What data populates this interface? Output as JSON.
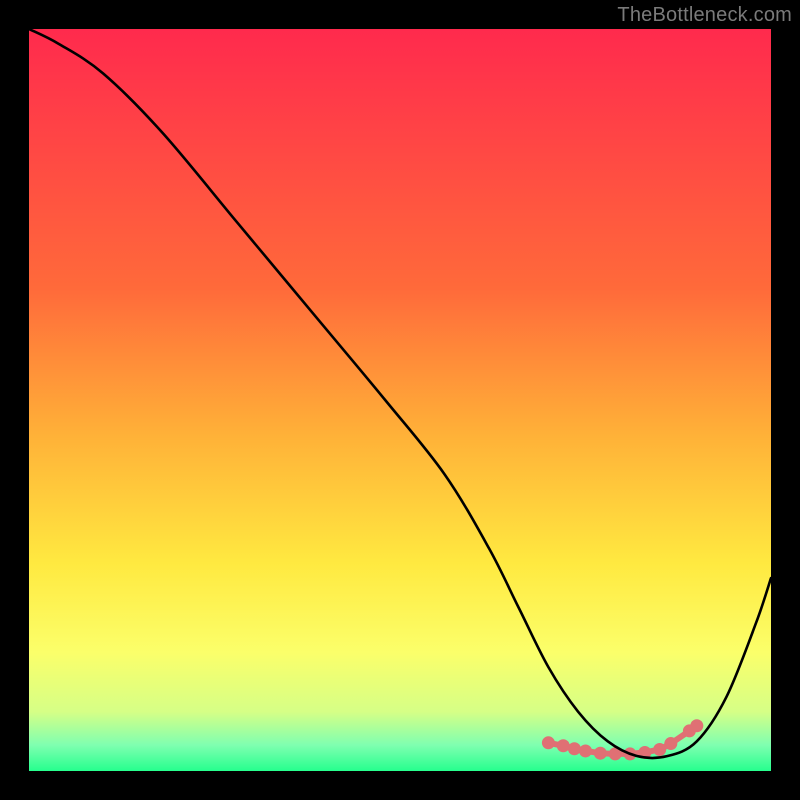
{
  "watermark": "TheBottleneck.com",
  "chart_data": {
    "type": "line",
    "title": "",
    "xlabel": "",
    "ylabel": "",
    "xlim": [
      0,
      100
    ],
    "ylim": [
      0,
      100
    ],
    "grid": false,
    "legend": "none",
    "gradient_stops": [
      {
        "offset": 0.0,
        "color": "#ff2a4d"
      },
      {
        "offset": 0.35,
        "color": "#ff6a3a"
      },
      {
        "offset": 0.55,
        "color": "#ffb238"
      },
      {
        "offset": 0.72,
        "color": "#ffe940"
      },
      {
        "offset": 0.84,
        "color": "#fbff6a"
      },
      {
        "offset": 0.92,
        "color": "#d6ff86"
      },
      {
        "offset": 0.965,
        "color": "#7fffb0"
      },
      {
        "offset": 1.0,
        "color": "#26ff8e"
      }
    ],
    "series": [
      {
        "name": "bottleneck-curve",
        "x": [
          0,
          4,
          10,
          18,
          28,
          38,
          48,
          56,
          62,
          66,
          70,
          74,
          78,
          82,
          86,
          90,
          94,
          98,
          100
        ],
        "y": [
          100,
          98,
          94,
          86,
          74,
          62,
          50,
          40,
          30,
          22,
          14,
          8,
          4,
          2,
          2,
          4,
          10,
          20,
          26
        ]
      }
    ],
    "highlight_points": {
      "name": "optimal-range-dots",
      "x": [
        70,
        72,
        73.5,
        75,
        77,
        79,
        81,
        83,
        85,
        86.5,
        89,
        90
      ],
      "y": [
        3.8,
        3.4,
        3.0,
        2.7,
        2.4,
        2.3,
        2.3,
        2.5,
        2.9,
        3.7,
        5.4,
        6.1
      ]
    }
  }
}
